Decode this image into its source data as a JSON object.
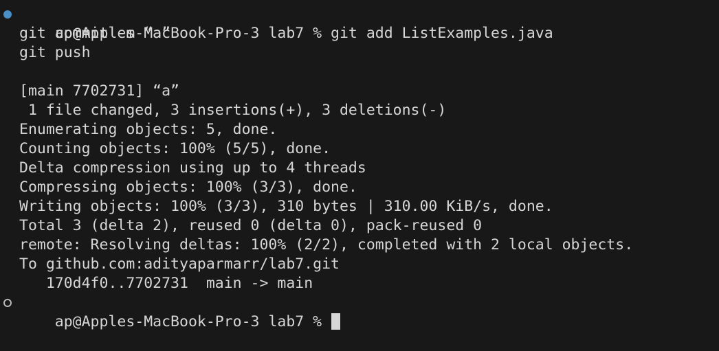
{
  "terminal": {
    "lines": [
      "ap@Apples-MacBook-Pro-3 lab7 % git add ListExamples.java",
      "git commit -m “a”",
      "git push",
      "",
      "[main 7702731] “a”",
      " 1 file changed, 3 insertions(+), 3 deletions(-)",
      "Enumerating objects: 5, done.",
      "Counting objects: 100% (5/5), done.",
      "Delta compression using up to 4 threads",
      "Compressing objects: 100% (3/3), done.",
      "Writing objects: 100% (3/3), 310 bytes | 310.00 KiB/s, done.",
      "Total 3 (delta 2), reused 0 (delta 0), pack-reused 0",
      "remote: Resolving deltas: 100% (2/2), completed with 2 local objects.",
      "To github.com:adityaparmarr/lab7.git",
      "   170d4f0..7702731  main -> main"
    ],
    "prompt": "ap@Apples-MacBook-Pro-3 lab7 % ",
    "marker_colors": {
      "previous_command": "#4a90c8",
      "current_command": "#b8b8b8"
    }
  }
}
